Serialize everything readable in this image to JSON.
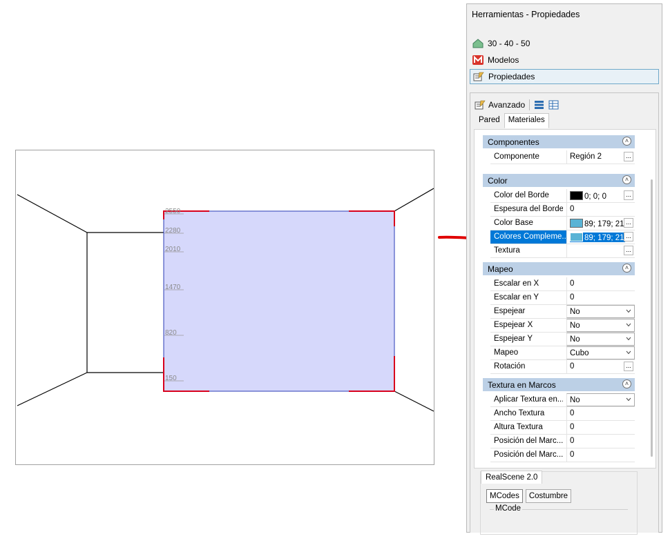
{
  "viewport": {
    "ruler_ticks": [
      "2550",
      "2280",
      "2010",
      "1470",
      "820",
      "150"
    ]
  },
  "panel": {
    "title": "Herramientas - Propiedades",
    "nav": [
      {
        "label": "30 - 40 - 50",
        "icon": "house-icon"
      },
      {
        "label": "Modelos",
        "icon": "models-m-icon"
      },
      {
        "label": "Propiedades",
        "icon": "properties-edit-icon"
      }
    ],
    "toolbar": {
      "advanced_label": "Avanzado"
    },
    "tabs": [
      "Pared",
      "Materiales"
    ],
    "categories": {
      "componentes": "Componentes",
      "color": "Color",
      "mapeo": "Mapeo",
      "textura_marcos": "Textura en Marcos"
    },
    "rows": {
      "componente": {
        "label": "Componente",
        "value": "Región 2"
      },
      "color_borde": {
        "label": "Color del Borde",
        "value": "0; 0; 0"
      },
      "espesura_borde": {
        "label": "Espesura del Borde",
        "value": "0"
      },
      "color_base": {
        "label": "Color Base",
        "value": "89; 179; 21"
      },
      "colores_comp": {
        "label": "Colores Compleme...",
        "value": "89; 179; 21"
      },
      "textura": {
        "label": "Textura",
        "value": ""
      },
      "escalar_x": {
        "label": "Escalar en X",
        "value": "0"
      },
      "escalar_y": {
        "label": "Escalar en Y",
        "value": "0"
      },
      "espejear": {
        "label": "Espejear",
        "value": "No"
      },
      "espejear_x": {
        "label": "Espejear X",
        "value": "No"
      },
      "espejear_y": {
        "label": "Espejear Y",
        "value": "No"
      },
      "mapeo": {
        "label": "Mapeo",
        "value": "Cubo"
      },
      "rotacion": {
        "label": "Rotación",
        "value": "0"
      },
      "aplicar_textura": {
        "label": "Aplicar Textura en...",
        "value": "No"
      },
      "ancho_textura": {
        "label": "Ancho Textura",
        "value": "0"
      },
      "altura_textura": {
        "label": "Altura Textura",
        "value": "0"
      },
      "posicion_1": {
        "label": "Posición del Marc...",
        "value": "0"
      },
      "posicion_2": {
        "label": "Posición del Marc...",
        "value": "0"
      }
    },
    "realscene": {
      "tab": "RealScene 2.0",
      "subtabs": [
        "MCodes",
        "Costumbre"
      ],
      "group_label": "MCode"
    },
    "colors": {
      "border_swatch": "#000000",
      "base_swatch": "#59b3d5",
      "selection": "#0078d7",
      "category_bg": "#bcd0e6"
    }
  }
}
